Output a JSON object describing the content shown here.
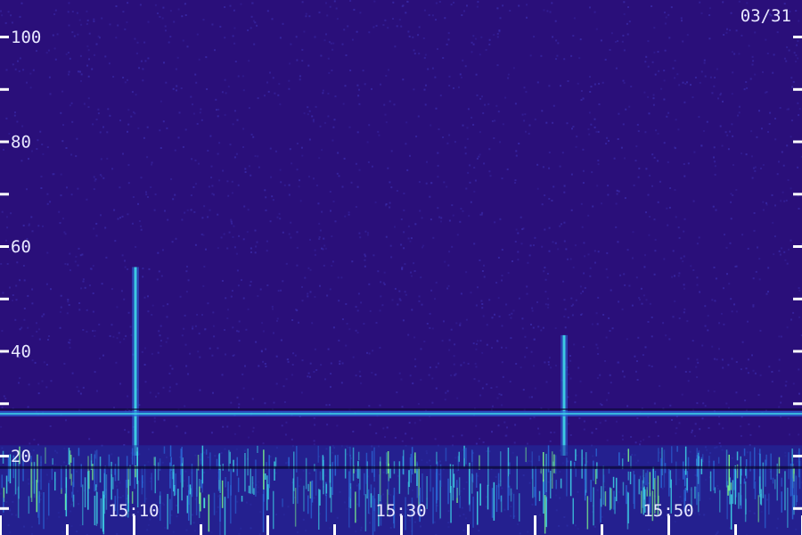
{
  "chart_data": {
    "type": "heatmap",
    "date": "03/31",
    "y_tick_labels": [
      100,
      80,
      60,
      40,
      20
    ],
    "y_range": [
      10,
      105
    ],
    "x_tick_labels": [
      "15:10",
      "15:30",
      "15:50"
    ],
    "x_range_minutes": [
      0,
      60
    ],
    "colors": {
      "background": "#2a0f7a",
      "noise_light": "#3a2aa8",
      "signal_mid": "#2b6ad8",
      "signal_high": "#3fd8e8",
      "signal_peak": "#7fff8a"
    },
    "features": [
      {
        "kind": "vertical_streak",
        "time": "15:10",
        "y_from": 20,
        "y_to": 56
      },
      {
        "kind": "vertical_streak",
        "time": "15:42",
        "y_from": 20,
        "y_to": 43
      },
      {
        "kind": "horizontal_band",
        "y": 28
      },
      {
        "kind": "low_frequency_noise",
        "y_from": 10,
        "y_to": 22
      }
    ]
  }
}
